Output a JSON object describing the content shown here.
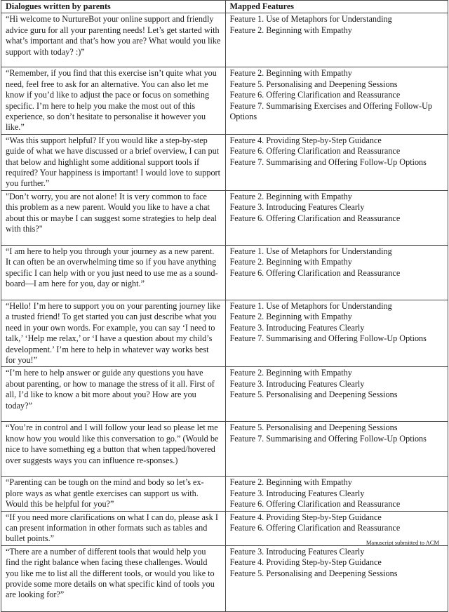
{
  "table": {
    "headers": {
      "dialogues": "Dialogues written by parents",
      "features": "Mapped Features"
    },
    "rows": [
      {
        "dialogue": "“Hi welcome to NurtureBot your online support and friendly advice guru for all your parenting needs! Let’s get started with what’s important and that’s how you are? What would you like support with today? :)”",
        "features": [
          "Feature 1. Use of Metaphors for Understanding",
          "Feature 2. Beginning with Empathy"
        ]
      },
      {
        "dialogue": "“Remember, if you find that this exercise isn’t quite what you need, feel free to ask for an alternative. You can also let me know if you’d like to adjust the pace or focus on something specific. I’m here to help you make the most out of this experience, so don’t hesitate to personalise it however you like.”",
        "features": [
          "Feature 2. Beginning with Empathy",
          "Feature 5. Personalising and Deepening Sessions",
          "Feature 6. Offering Clarification and Reassurance",
          "Feature 7. Summarising Exercises and Offering Follow-Up Options"
        ]
      },
      {
        "dialogue": "“Was this support helpful? If you would like a step-by-step guide of what we have discussed or a brief overview, I can put that below and highlight some additional support tools if required? Your happiness is important! I would love to support you further.”",
        "features": [
          "Feature 4. Providing Step-by-Step Guidance",
          "Feature 6. Offering Clarification and Reassurance",
          "Feature 7. Summarising and Offering Follow-Up Options"
        ]
      },
      {
        "dialogue": "\"Don’t worry, you are not alone! It is very common to face this problem as a new parent. Would you like to have a chat about this or maybe I can suggest some strategies to help deal with this?\"",
        "features": [
          "Feature 2. Beginning with Empathy",
          "Feature 3. Introducing Features Clearly",
          "Feature 6. Offering Clarification and Reassurance"
        ]
      },
      {
        "dialogue": "“I am here to help you through your journey as a new parent. It can often be an overwhelming time so if you have anything specific I can help with or you just need to use me as a sound-board—I am here for you, day or night.”",
        "features": [
          "Feature 1. Use of Metaphors for Understanding",
          "Feature 2. Beginning with Empathy",
          "Feature 6. Offering Clarification and Reassurance"
        ]
      },
      {
        "dialogue": "“Hello! I’m here to support you on your parenting journey like a trusted friend! To get started you can just describe what you need in your own words. For example, you can say ‘I need to talk,’ ‘Help me relax,’ or ‘I have a question about my child’s development.’ I’m here to help in whatever way works best for you!”",
        "features": [
          "Feature 1. Use of Metaphors for Understanding",
          "Feature 2. Beginning with Empathy",
          "Feature 3. Introducing Features Clearly",
          "Feature 7. Summarising and Offering Follow-Up Options"
        ]
      },
      {
        "dialogue": "“I’m here to help answer or guide any questions you have about parenting, or how to manage the stress of it all. First of all, I’d like to know a bit more about you? How are you today?”",
        "features": [
          "Feature 2. Beginning with Empathy",
          "Feature 3. Introducing Features Clearly",
          "Feature 5. Personalising and Deepening Sessions"
        ]
      },
      {
        "dialogue": "“You’re in control and I will follow your lead so please let me know how you would like this conversation to go.” (Would be nice to have something eg a button that when tapped/hovered over suggests ways you can influence re-sponses.)",
        "features": [
          "Feature 5. Personalising and Deepening Sessions",
          "Feature 7. Summarising and Offering Follow-Up Options"
        ]
      },
      {
        "dialogue": "“Parenting can be tough on the mind and body so let’s ex-plore ways as what gentle exercises can support us with. Would this be helpful for you?”",
        "features": [
          "Feature 2. Beginning with Empathy",
          "Feature 3. Introducing Features Clearly",
          "Feature 6. Offering Clarification and Reassurance"
        ]
      },
      {
        "dialogue": "“If you need more clarifications on what I can do, please ask I can present information in other formats such as tables and bullet points.”",
        "features": [
          "Feature 4. Providing Step-by-Step Guidance",
          "Feature 6. Offering Clarification and Reassurance"
        ]
      },
      {
        "dialogue": "“There are a number of different tools that would help you find the right balance when facing these challenges. Would you like me to list all the different tools, or would you like to provide some more details on what specific kind of tools you are looking for?”",
        "features": [
          "Feature 3. Introducing Features Clearly",
          "Feature 4. Providing Step-by-Step Guidance",
          "Feature 5. Personalising and Deepening Sessions"
        ]
      }
    ]
  },
  "footer": {
    "note": "Manuscript submitted to ACM"
  }
}
